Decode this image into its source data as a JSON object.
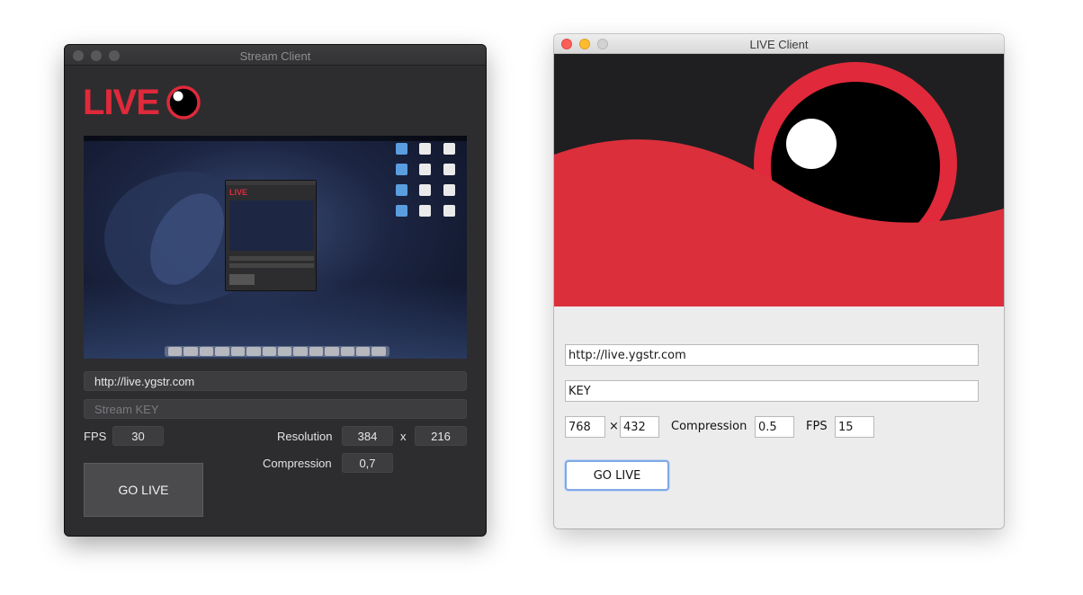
{
  "stream_client": {
    "title": "Stream Client",
    "logo_text": "LIVE",
    "url_value": "http://live.ygstr.com",
    "key_placeholder": "Stream KEY",
    "fps_label": "FPS",
    "fps_value": "30",
    "resolution_label": "Resolution",
    "res_width": "384",
    "res_x": "x",
    "res_height": "216",
    "compression_label": "Compression",
    "compression_value": "0,7",
    "go_live_label": "GO LIVE",
    "preview_logo_text": "LIVE"
  },
  "live_client": {
    "title": "LIVE Client",
    "url_value": "http://live.ygstr.com",
    "key_value": "KEY",
    "width_value": "768",
    "times_symbol": "×",
    "height_value": "432",
    "compression_label": "Compression",
    "compression_value": "0.5",
    "fps_label": "FPS",
    "fps_value": "15",
    "go_live_label": "GO LIVE"
  },
  "colors": {
    "brand_red": "#e0293a",
    "close_red": "#fc5f57",
    "minimize_yellow": "#fdbc2e",
    "zoom_gray": "#d2d2d2"
  }
}
